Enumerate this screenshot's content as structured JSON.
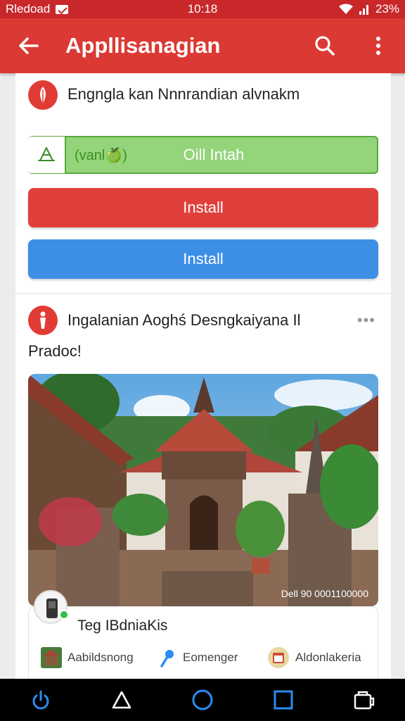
{
  "status_bar": {
    "left_text": "Rledoad",
    "time": "10:18",
    "battery": "23%",
    "icons": [
      "notification-icon",
      "wifi-icon",
      "signal-icon"
    ]
  },
  "app_bar": {
    "title": "Appllisanagian",
    "icons": [
      "back-arrow-icon",
      "search-icon",
      "more-vert-icon"
    ],
    "color": "#db3a34"
  },
  "post1": {
    "title": "Engngla kan Nnnrandian alvnakm",
    "green_button": {
      "small_label": "(vanl🍏)",
      "label": "Oill Intah",
      "color": "#94d47a"
    },
    "install_red": {
      "label": "Install",
      "color": "#e0403c"
    },
    "install_blue": {
      "label": "Install",
      "color": "#3d8fe6"
    }
  },
  "post2": {
    "title": "Ingalanian Aoghś Desngkaiyana Il",
    "more": "•••",
    "subtext": "Pradoc!",
    "photo_caption": "Dell 90 0001100000",
    "sub_card": {
      "title": "Teg IBdniaKis",
      "links": [
        {
          "label": "Aabildsnong",
          "icon": "photo-thumb-icon"
        },
        {
          "label": "Eomenger",
          "icon": "pin-icon"
        },
        {
          "label": "Aldonlakeria",
          "icon": "calendar-thumb-icon"
        }
      ]
    }
  },
  "nav_bar": {
    "icons": [
      "power-icon",
      "back-triangle-icon",
      "home-circle-icon",
      "recents-square-icon",
      "screenshot-icon"
    ],
    "accent": "#2a8cf0"
  }
}
